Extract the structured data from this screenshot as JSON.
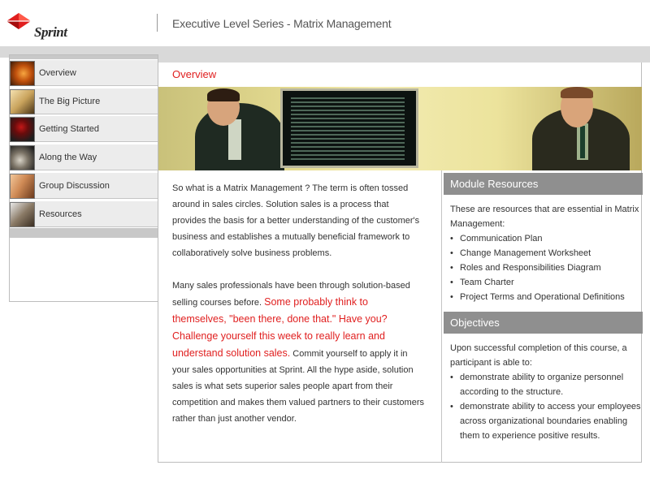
{
  "brand": {
    "logo_text": "Sprint",
    "color": "#e01f1f"
  },
  "header": {
    "title": "Executive Level Series - Matrix Management"
  },
  "sidebar": {
    "items": [
      {
        "label": "Overview",
        "icon": "globe-thumbnail-icon"
      },
      {
        "label": "The Big Picture",
        "icon": "hand-writing-thumbnail-icon"
      },
      {
        "label": "Getting Started",
        "icon": "red-rose-thumbnail-icon"
      },
      {
        "label": "Along the Way",
        "icon": "stone-path-thumbnail-icon"
      },
      {
        "label": "Group Discussion",
        "icon": "handshake-thumbnail-icon"
      },
      {
        "label": "Resources",
        "icon": "pen-thumbnail-icon"
      }
    ]
  },
  "main": {
    "section_title": "Overview",
    "paragraph1": "So what is a Matrix Management ? The term is often tossed around in sales circles. Solution sales is a process that provides the basis for a better understanding of the customer's business and establishes a mutually beneficial framework to collaboratively solve business problems.",
    "paragraph2_start": "Many sales professionals have been through solution-based selling courses before. ",
    "paragraph2_highlight": "Some probably think to themselves, \"been there, done that.\" Have you? Challenge yourself this week to really learn and understand solution sales.",
    "paragraph2_end": " Commit yourself to apply it in your sales opportunities at Sprint. All the hype aside, solution sales is what sets superior sales people apart from their competition and makes them valued partners to their customers rather than just another vendor."
  },
  "module_resources": {
    "title": "Module Resources",
    "intro": "These are resources that are essential in Matrix Management:",
    "items": [
      "Communication Plan",
      "Change Management Worksheet",
      "Roles and Responsibilities Diagram",
      "Team Charter",
      "Project Terms and Operational Definitions"
    ]
  },
  "objectives": {
    "title": "Objectives",
    "intro": "Upon successful completion of this course, a participant is able to:",
    "items": [
      "demonstrate ability to organize personnel according to the structure.",
      "demonstrate ability to access your employees across organizational boundaries enabling them to experience positive results."
    ]
  }
}
